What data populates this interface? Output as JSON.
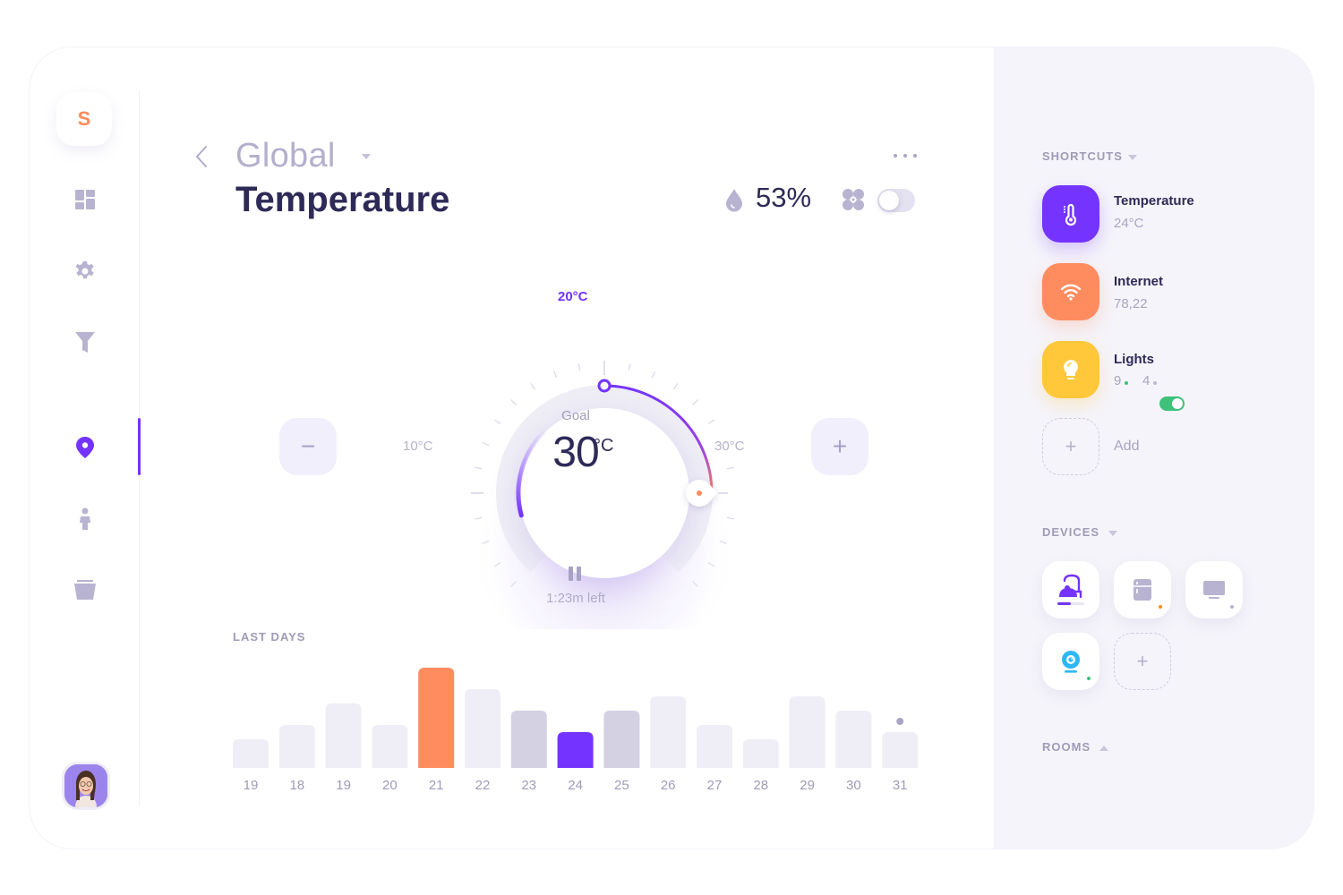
{
  "sidebar": {
    "logo_letter": "S",
    "items": [
      {
        "name": "dashboard",
        "icon": "dashboard-icon",
        "active": false
      },
      {
        "name": "settings",
        "icon": "gear-icon",
        "active": false
      },
      {
        "name": "filter",
        "icon": "filter-icon",
        "active": false
      },
      {
        "name": "location",
        "icon": "location-pin-icon",
        "active": true
      },
      {
        "name": "person",
        "icon": "person-icon",
        "active": false
      },
      {
        "name": "bucket",
        "icon": "bucket-icon",
        "active": false
      }
    ],
    "avatar": "user-avatar"
  },
  "header": {
    "context": "Global",
    "title": "Temperature",
    "humidity": "53%",
    "fan_on": false
  },
  "dial": {
    "set_label": "20°C",
    "min_label": "10°C",
    "max_label": "30°C",
    "goal_label": "Goal",
    "goal_value": "30",
    "goal_unit": "°C",
    "time_left": "1:23m left",
    "minus_label": "−",
    "plus_label": "+",
    "current_temp_c": 20,
    "goal_temp_c": 30,
    "range_c": [
      10,
      30
    ]
  },
  "colors": {
    "accent": "#7433ff",
    "orange": "#ff8c5f",
    "yellow": "#ffc73a",
    "bar_light": "#efeef6",
    "bar_mid": "#d4d1e3",
    "green": "#3fc17a"
  },
  "chart_data": {
    "type": "bar",
    "title": "LAST DAYS",
    "categories": [
      "19",
      "18",
      "19",
      "20",
      "21",
      "22",
      "23",
      "24",
      "25",
      "26",
      "27",
      "28",
      "29",
      "30",
      "31"
    ],
    "values": [
      2,
      3,
      4.5,
      3,
      7,
      5.5,
      4,
      2.5,
      4,
      5,
      3,
      2,
      5,
      4,
      2.5
    ],
    "highlight": {
      "4": "orange",
      "7": "accent",
      "6": "mid",
      "8": "mid"
    },
    "marker_on": 14,
    "ylim": [
      0,
      7
    ],
    "xlabel": "",
    "ylabel": ""
  },
  "shortcuts": {
    "title": "SHORTCUTS",
    "items": [
      {
        "name": "Temperature",
        "value": "24°C",
        "icon": "thermometer-icon",
        "color": "#7433ff"
      },
      {
        "name": "Internet",
        "value": "78,22",
        "icon": "wifi-icon",
        "color": "#ff8c5f"
      },
      {
        "name": "Lights",
        "value_on": "9",
        "value_off": "4",
        "icon": "lightbulb-icon",
        "color": "#ffc73a",
        "toggle_on": true
      }
    ],
    "add_label": "Add",
    "add_icon": "+"
  },
  "devices": {
    "title": "DEVICES",
    "items": [
      {
        "name": "vacuum",
        "icon": "vacuum-icon",
        "progress": 0.5
      },
      {
        "name": "fridge",
        "icon": "fridge-icon",
        "status": "orange"
      },
      {
        "name": "tv",
        "icon": "monitor-icon",
        "status": "gray"
      },
      {
        "name": "webcam",
        "icon": "webcam-icon",
        "status": "green"
      }
    ],
    "add_icon": "+"
  },
  "rooms": {
    "title": "ROOMS"
  }
}
